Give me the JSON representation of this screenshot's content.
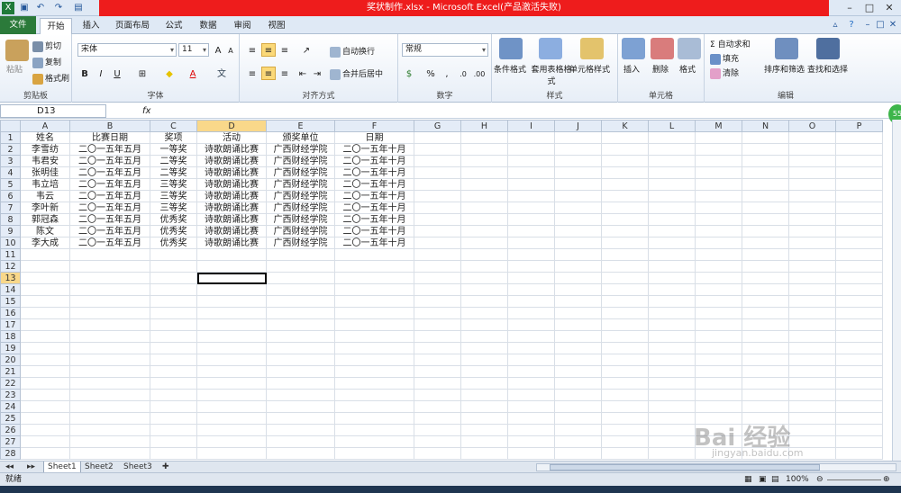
{
  "window": {
    "title": "奖状制作.xlsx - Microsoft Excel(产品激活失败)"
  },
  "tabs": [
    "文件",
    "开始",
    "插入",
    "页面布局",
    "公式",
    "数据",
    "审阅",
    "视图"
  ],
  "ribbon": {
    "clipboard": {
      "paste": "粘贴",
      "cut": "剪切",
      "copy": "复制",
      "format_painter": "格式刷",
      "label": "剪贴板"
    },
    "font": {
      "name": "宋体",
      "size": "11",
      "label": "字体"
    },
    "alignment": {
      "wrap": "自动换行",
      "merge": "合并后居中",
      "label": "对齐方式"
    },
    "number": {
      "format": "常规",
      "label": "数字"
    },
    "styles": {
      "conditional": "条件格式",
      "table": "套用表格格式",
      "cell": "单元格样式",
      "label": "样式"
    },
    "cells": {
      "insert": "插入",
      "delete": "删除",
      "format": "格式",
      "label": "单元格"
    },
    "editing": {
      "autosum": "自动求和",
      "fill": "填充",
      "clear": "清除",
      "sort": "排序和筛选",
      "find": "查找和选择",
      "label": "编辑"
    }
  },
  "formula_bar": {
    "name_box": "D13",
    "fx": "fx"
  },
  "sheet": {
    "columns": [
      "A",
      "B",
      "C",
      "D",
      "E",
      "F",
      "G",
      "H",
      "I",
      "J",
      "K",
      "L",
      "M",
      "N",
      "O",
      "P"
    ],
    "rows": [
      [
        "姓名",
        "比赛日期",
        "奖项",
        "活动",
        "颁奖单位",
        "日期"
      ],
      [
        "李雪纺",
        "二〇一五年五月",
        "一等奖",
        "诗歌朗诵比赛",
        "广西财经学院",
        "二〇一五年十月"
      ],
      [
        "韦君安",
        "二〇一五年五月",
        "二等奖",
        "诗歌朗诵比赛",
        "广西财经学院",
        "二〇一五年十月"
      ],
      [
        "张明佳",
        "二〇一五年五月",
        "二等奖",
        "诗歌朗诵比赛",
        "广西财经学院",
        "二〇一五年十月"
      ],
      [
        "韦立培",
        "二〇一五年五月",
        "三等奖",
        "诗歌朗诵比赛",
        "广西财经学院",
        "二〇一五年十月"
      ],
      [
        "韦云",
        "二〇一五年五月",
        "三等奖",
        "诗歌朗诵比赛",
        "广西财经学院",
        "二〇一五年十月"
      ],
      [
        "李叶新",
        "二〇一五年五月",
        "三等奖",
        "诗歌朗诵比赛",
        "广西财经学院",
        "二〇一五年十月"
      ],
      [
        "郭冠森",
        "二〇一五年五月",
        "优秀奖",
        "诗歌朗诵比赛",
        "广西财经学院",
        "二〇一五年十月"
      ],
      [
        "陈文",
        "二〇一五年五月",
        "优秀奖",
        "诗歌朗诵比赛",
        "广西财经学院",
        "二〇一五年十月"
      ],
      [
        "李大成",
        "二〇一五年五月",
        "优秀奖",
        "诗歌朗诵比赛",
        "广西财经学院",
        "二〇一五年十月"
      ]
    ],
    "total_rows": 28,
    "active_row": 13,
    "active_col": "D"
  },
  "sheet_tabs": [
    "Sheet1",
    "Sheet2",
    "Sheet3"
  ],
  "status": {
    "ready": "就绪",
    "zoom": "100%"
  },
  "watermark": {
    "text": "Bai 经验",
    "url": "jingyan.baidu.com"
  }
}
